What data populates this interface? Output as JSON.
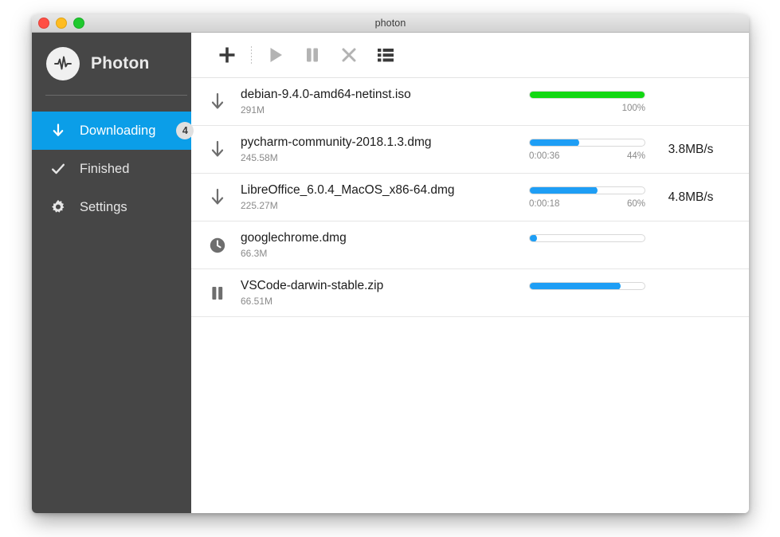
{
  "window": {
    "title": "photon",
    "controls": [
      {
        "name": "close",
        "color": "#ff4f44"
      },
      {
        "name": "minimize",
        "color": "#ffbc21"
      },
      {
        "name": "maximize",
        "color": "#1fc92e"
      }
    ]
  },
  "sidebar": {
    "brand": {
      "name": "Photon",
      "logo_icon": "pulse-waveform-icon"
    },
    "items": [
      {
        "label": "Downloading",
        "icon": "download-arrow-icon",
        "badge": "4",
        "active": true
      },
      {
        "label": "Finished",
        "icon": "checkmark-icon",
        "badge": "",
        "active": false
      },
      {
        "label": "Settings",
        "icon": "gear-icon",
        "badge": "",
        "active": false
      }
    ]
  },
  "toolbar": {
    "buttons": [
      {
        "name": "add-download-button",
        "icon": "plus-icon",
        "label": "Add",
        "state": "enabled"
      },
      {
        "name": "start-button",
        "icon": "play-icon",
        "label": "Start",
        "state": "disabled"
      },
      {
        "name": "pause-button",
        "icon": "pause-icon",
        "label": "Pause",
        "state": "disabled"
      },
      {
        "name": "remove-button",
        "icon": "close-x-icon",
        "label": "Remove",
        "state": "disabled"
      },
      {
        "name": "list-view-button",
        "icon": "list-icon",
        "label": "List",
        "state": "enabled"
      }
    ]
  },
  "downloads": [
    {
      "name": "debian-9.4.0-amd64-netinst.iso",
      "size": "291M",
      "status_icon": "download-arrow-icon",
      "progress": 100,
      "progress_color": "#12d812",
      "percent_label": "100%",
      "eta": "",
      "speed": ""
    },
    {
      "name": "pycharm-community-2018.1.3.dmg",
      "size": "245.58M",
      "status_icon": "download-arrow-icon",
      "progress": 44,
      "progress_color": "#1e9ef5",
      "percent_label": "44%",
      "eta": "0:00:36",
      "speed": "3.8MB/s"
    },
    {
      "name": "LibreOffice_6.0.4_MacOS_x86-64.dmg",
      "size": "225.27M",
      "status_icon": "download-arrow-icon",
      "progress": 60,
      "progress_color": "#1e9ef5",
      "percent_label": "60%",
      "eta": "0:00:18",
      "speed": "4.8MB/s"
    },
    {
      "name": "googlechrome.dmg",
      "size": "66.3M",
      "status_icon": "clock-icon",
      "progress": 4,
      "progress_color": "#1e9ef5",
      "percent_label": "",
      "eta": "",
      "speed": ""
    },
    {
      "name": "VSCode-darwin-stable.zip",
      "size": "66.51M",
      "status_icon": "pause-icon",
      "progress": 80,
      "progress_color": "#1e9ef5",
      "percent_label": "",
      "eta": "",
      "speed": ""
    }
  ],
  "colors": {
    "sidebar_bg": "#464646",
    "accent_blue": "#0b9ee8",
    "progress_blue": "#1e9ef5",
    "progress_green": "#12d812",
    "content_bg": "#ffffff"
  }
}
